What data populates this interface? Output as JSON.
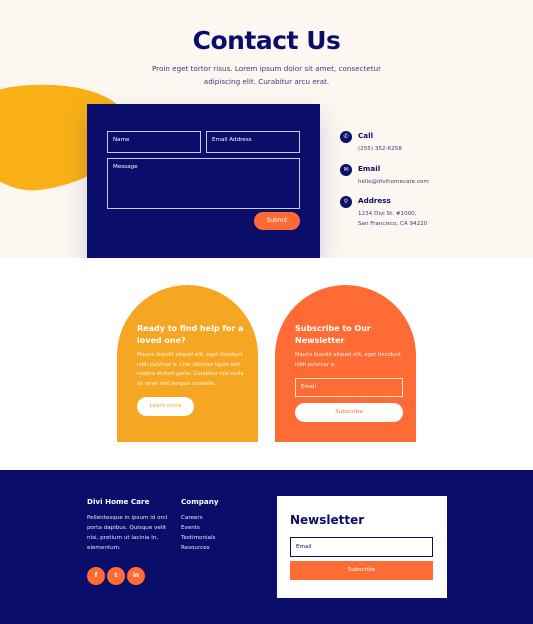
{
  "contact": {
    "title": "Contact Us",
    "intro": "Proin eget tortor risus. Lorem ipsum dolor sit amet, consectetur adipiscing elit. Curabitur arcu erat.",
    "form": {
      "name_placeholder": "Name",
      "email_placeholder": "Email Address",
      "message_placeholder": "Message",
      "submit_label": "Submit"
    },
    "info": [
      {
        "icon": "phone-icon",
        "glyph": "✆",
        "title": "Call",
        "lines": [
          "(255) 352-6258"
        ]
      },
      {
        "icon": "envelope-icon",
        "glyph": "✉",
        "title": "Email",
        "lines": [
          "hello@divihomecare.com"
        ]
      },
      {
        "icon": "map-pin-icon",
        "glyph": "⚲",
        "title": "Address",
        "lines": [
          "1234 Divi St. #1000,",
          "San Francisco, CA 94220"
        ]
      }
    ]
  },
  "cards": {
    "help": {
      "title": "Ready to find help for a loved one?",
      "text": "Mauris blandit aliquet elit, eget tincidunt nibh pulvinar a. Cras ultricies ligula sed magna dictum porta. Curabitur non nulla sit amet nisl tempus convallis.",
      "button": "Learn more"
    },
    "subscribe": {
      "title": "Subscribe to Our Newsletter",
      "text": "Mauris blandit aliquet elit, eget tincidunt nibh pulvinar a.",
      "email_placeholder": "Email",
      "button": "Subscribe"
    }
  },
  "footer": {
    "brand_title": "Divi Home Care",
    "about": "Pellentesque in ipsum id orci porta dapibus. Quisque velit nisi, pretium ut lacinia in, elementum.",
    "company_title": "Company",
    "links": [
      "Careers",
      "Events",
      "Testimonials",
      "Resources"
    ],
    "social": [
      {
        "name": "facebook-icon",
        "glyph": "f"
      },
      {
        "name": "twitter-icon",
        "glyph": "t"
      },
      {
        "name": "linkedin-icon",
        "glyph": "in"
      }
    ],
    "newsletter": {
      "title": "Newsletter",
      "email_placeholder": "Email",
      "button": "Subscribe"
    }
  },
  "colors": {
    "navy": "#0b0d6b",
    "orange": "#ff6b35",
    "yellow": "#f5a623",
    "cream": "#fdf7f2"
  }
}
